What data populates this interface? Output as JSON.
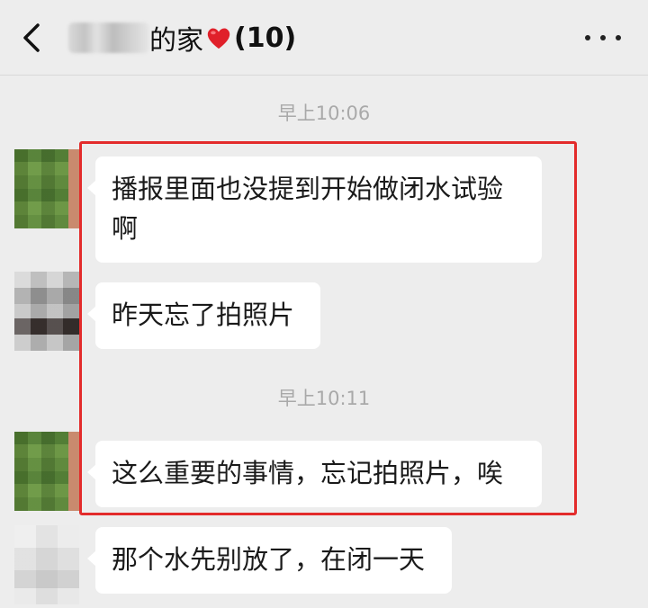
{
  "header": {
    "title": "的家",
    "member_count": "(10)",
    "heart_icon": "red-heart-emoji",
    "back_icon": "chevron-left-icon",
    "more_icon": "more-dots-icon"
  },
  "timestamps": [
    "早上10:06",
    "早上10:11"
  ],
  "messages": [
    {
      "avatar": "green-blurred",
      "text_line1": "播报里面也没提到开始做闭水试验",
      "text_line2": "啊"
    },
    {
      "avatar": "gray-blurred",
      "text": "昨天忘了拍照片"
    },
    {
      "avatar": "green-blurred",
      "text": "这么重要的事情，忘记拍照片，唉"
    },
    {
      "avatar": "light-blurred",
      "text": "那个水先别放了，在闭一天"
    }
  ],
  "highlight_color": "#e32b2b"
}
